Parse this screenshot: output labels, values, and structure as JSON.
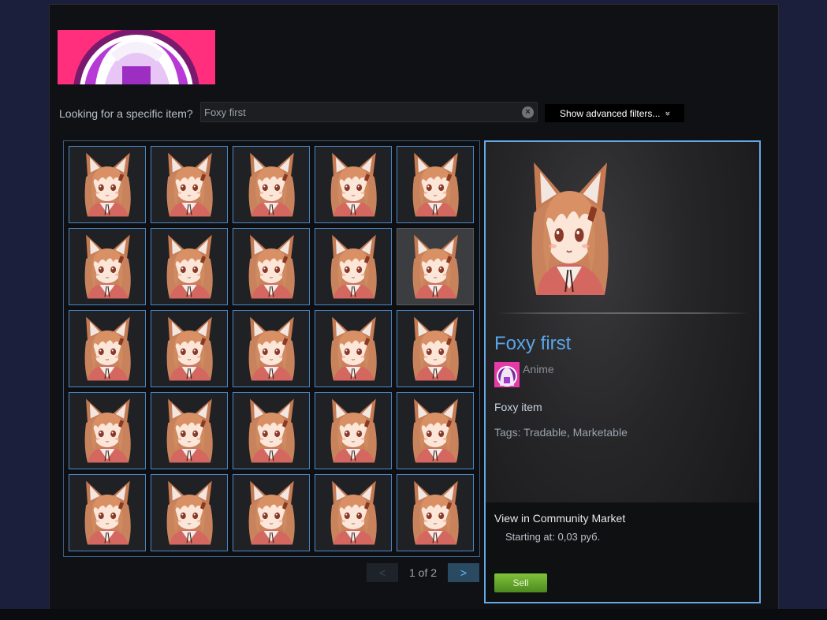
{
  "search": {
    "label": "Looking for a specific item?",
    "value": "Foxy first",
    "clear_glyph": "×",
    "advanced_label": "Show advanced filters...",
    "advanced_glyph": "»"
  },
  "grid": {
    "rows": 5,
    "cols": 5,
    "selected_index": 9,
    "item_icon": "fox-girl-avatar"
  },
  "pager": {
    "prev": "<",
    "text": "1 of 2",
    "next": ">"
  },
  "detail": {
    "name": "Foxy first",
    "game": "Anime",
    "description": "Foxy item",
    "tags": "Tags: Tradable, Marketable",
    "market_link": "View in Community Market",
    "price": "Starting at: 0,03 руб.",
    "sell_label": "Sell"
  },
  "colors": {
    "accent_blue": "#67a8e6",
    "name_blue": "#5aa5e8",
    "sell_green": "#6fb630",
    "banner_pink": "#ff2f7d"
  }
}
